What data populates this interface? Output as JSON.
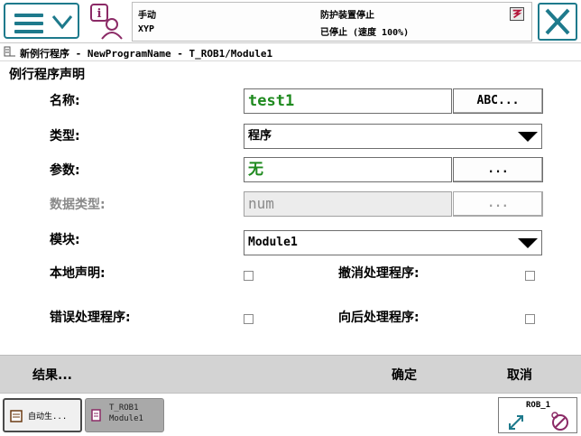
{
  "status": {
    "mode": "手动",
    "user": "XYP",
    "safety": "防护装置停止",
    "state": "已停止 (速度 100%)"
  },
  "breadcrumb": "新例行程序 - NewProgramName - T_ROB1/Module1",
  "form": {
    "section_title": "例行程序声明",
    "name_label": "名称:",
    "name_value": "test1",
    "name_button": "ABC...",
    "type_label": "类型:",
    "type_value": "程序",
    "params_label": "参数:",
    "params_value": "无",
    "params_button": "...",
    "datatype_label": "数据类型:",
    "datatype_value": "num",
    "datatype_button": "...",
    "module_label": "模块:",
    "module_value": "Module1",
    "local_label": "本地声明:",
    "undo_label": "撤消处理程序:",
    "error_label": "错误处理程序:",
    "backward_label": "向后处理程序:"
  },
  "commands": {
    "result": "结果...",
    "ok": "确定",
    "cancel": "取消"
  },
  "taskbar": {
    "auto_task": "自动生...",
    "program_task_line1": "T_ROB1",
    "program_task_line2": "Module1",
    "robot": "ROB_1"
  },
  "colors": {
    "accent": "#1e7a8c",
    "value_green": "#1f8a1f",
    "command_bar": "#d3d3d3"
  },
  "icons": [
    "menu-icon",
    "chevron-down-icon",
    "operator-info-icon",
    "alarm-icon",
    "close-icon",
    "program-icon",
    "dropdown-arrow-icon",
    "robot-jog-icon"
  ]
}
